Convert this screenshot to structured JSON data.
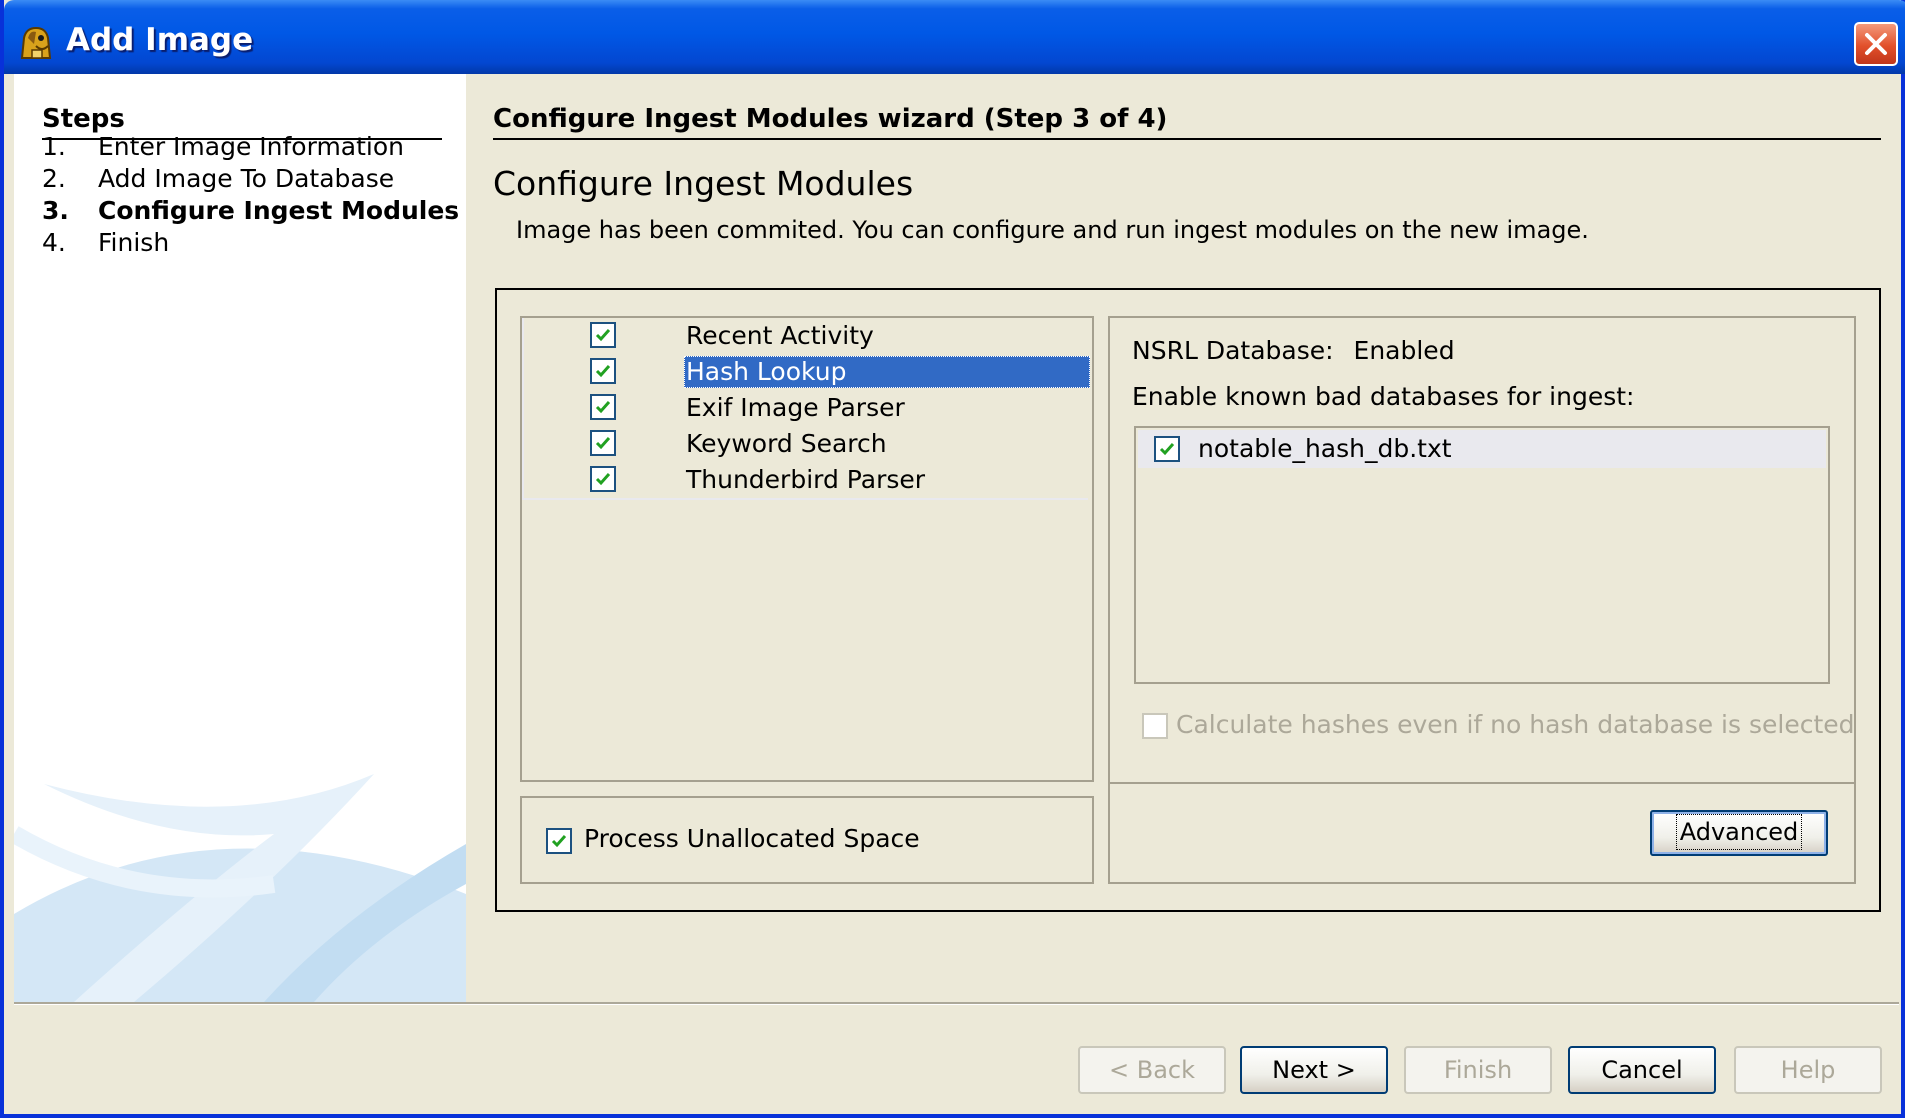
{
  "window": {
    "title": "Add Image",
    "icon": "autopsy-dog-icon",
    "close_icon": "close-icon"
  },
  "sidebar": {
    "heading": "Steps",
    "steps": [
      {
        "num": "1.",
        "label": "Enter Image Information",
        "active": false
      },
      {
        "num": "2.",
        "label": "Add Image To Database",
        "active": false
      },
      {
        "num": "3.",
        "label": "Configure Ingest Modules",
        "active": true
      },
      {
        "num": "4.",
        "label": "Finish",
        "active": false
      }
    ]
  },
  "main": {
    "wizard_heading": "Configure Ingest Modules wizard (Step 3 of 4)",
    "title": "Configure Ingest Modules",
    "description": "Image has been commited.  You can configure and run ingest modules on the new image."
  },
  "modules": [
    {
      "label": "Recent Activity",
      "checked": true,
      "selected": false
    },
    {
      "label": "Hash Lookup",
      "checked": true,
      "selected": true
    },
    {
      "label": "Exif Image Parser",
      "checked": true,
      "selected": false
    },
    {
      "label": "Keyword Search",
      "checked": true,
      "selected": false
    },
    {
      "label": "Thunderbird Parser",
      "checked": true,
      "selected": false
    }
  ],
  "unallocated": {
    "label": "Process Unallocated Space",
    "checked": true
  },
  "settings": {
    "nsrl_label": "NSRL Database:",
    "nsrl_value": "Enabled",
    "enable_label": "Enable known bad databases for ingest:",
    "databases": [
      {
        "label": "notable_hash_db.txt",
        "checked": true
      }
    ],
    "calc_label": "Calculate hashes even if no hash database is selected",
    "calc_checked": false,
    "calc_enabled": false,
    "advanced_label": "Advanced"
  },
  "buttons": {
    "back": "< Back",
    "next": "Next >",
    "finish": "Finish",
    "cancel": "Cancel",
    "help": "Help"
  },
  "colors": {
    "titlebar": "#0058e6",
    "selection": "#316ac5",
    "dialog_bg": "#ece9d8",
    "check": "#21a121"
  }
}
